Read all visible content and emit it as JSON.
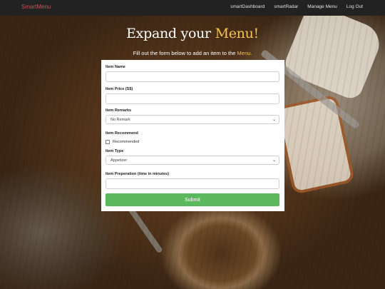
{
  "navbar": {
    "brand": "SmartMenu",
    "links": [
      "smartDashboard",
      "smartRadar",
      "Manage Menu",
      "Log Out"
    ]
  },
  "hero": {
    "title_part1": "Expand your ",
    "title_accent": "Menu!",
    "subtitle_part1": "Fill out the form below to add an item to the ",
    "subtitle_accent": "Menu."
  },
  "form": {
    "item_name_label": "Item Name",
    "item_name_value": "",
    "item_price_label": "Item Price (S$)",
    "item_price_value": "",
    "remarks_label": "Item Remarks",
    "remarks_selected": "No Remark",
    "recommend_label": "Item Recommend",
    "recommended_checkbox_label": "Recommended",
    "recommended_checked": false,
    "type_label": "Item Type",
    "type_selected": "Appetizer",
    "prep_label": "Item Preperation (time in minutes)",
    "prep_value": "",
    "submit_label": "Submit"
  },
  "colors": {
    "navbar_bg": "#222222",
    "brand": "#c9505a",
    "accent": "#f2c350",
    "submit": "#5cb85c"
  },
  "icons": {
    "select_arrow": "chevron-down-icon"
  }
}
